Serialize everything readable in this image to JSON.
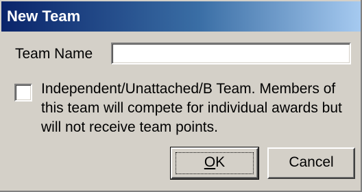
{
  "window": {
    "title": "New Team"
  },
  "form": {
    "team_name_label": "Team Name",
    "team_name_value": "",
    "team_name_placeholder": "",
    "checkbox_checked": false,
    "checkbox_lines": [
      "Independent/Unattached/B Team.  Members of",
      "this team will compete for individual awards but",
      "will not receive team points."
    ]
  },
  "buttons": {
    "ok_mnemonic": "O",
    "ok_rest": "K",
    "cancel_label": "Cancel"
  },
  "colors": {
    "title_gradient_start": "#0a246a",
    "title_gradient_end": "#a6caf0",
    "dialog_background": "#d4d0c8"
  }
}
